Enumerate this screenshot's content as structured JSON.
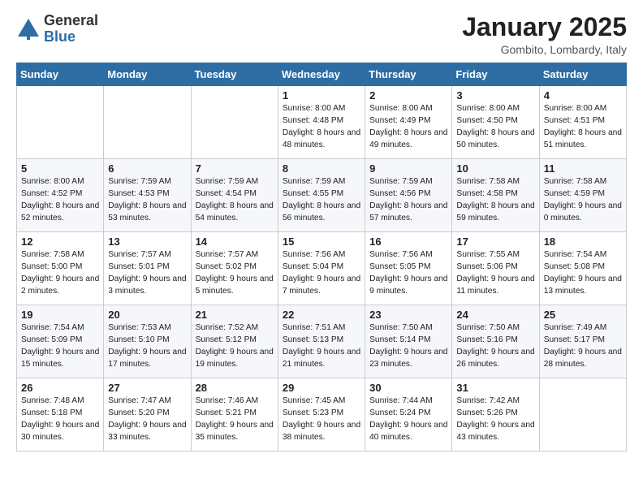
{
  "logo": {
    "general": "General",
    "blue": "Blue"
  },
  "title": "January 2025",
  "location": "Gombito, Lombardy, Italy",
  "weekdays": [
    "Sunday",
    "Monday",
    "Tuesday",
    "Wednesday",
    "Thursday",
    "Friday",
    "Saturday"
  ],
  "weeks": [
    [
      {
        "day": "",
        "sunrise": "",
        "sunset": "",
        "daylight": "",
        "empty": true
      },
      {
        "day": "",
        "sunrise": "",
        "sunset": "",
        "daylight": "",
        "empty": true
      },
      {
        "day": "",
        "sunrise": "",
        "sunset": "",
        "daylight": "",
        "empty": true
      },
      {
        "day": "1",
        "sunrise": "Sunrise: 8:00 AM",
        "sunset": "Sunset: 4:48 PM",
        "daylight": "Daylight: 8 hours and 48 minutes."
      },
      {
        "day": "2",
        "sunrise": "Sunrise: 8:00 AM",
        "sunset": "Sunset: 4:49 PM",
        "daylight": "Daylight: 8 hours and 49 minutes."
      },
      {
        "day": "3",
        "sunrise": "Sunrise: 8:00 AM",
        "sunset": "Sunset: 4:50 PM",
        "daylight": "Daylight: 8 hours and 50 minutes."
      },
      {
        "day": "4",
        "sunrise": "Sunrise: 8:00 AM",
        "sunset": "Sunset: 4:51 PM",
        "daylight": "Daylight: 8 hours and 51 minutes."
      }
    ],
    [
      {
        "day": "5",
        "sunrise": "Sunrise: 8:00 AM",
        "sunset": "Sunset: 4:52 PM",
        "daylight": "Daylight: 8 hours and 52 minutes."
      },
      {
        "day": "6",
        "sunrise": "Sunrise: 7:59 AM",
        "sunset": "Sunset: 4:53 PM",
        "daylight": "Daylight: 8 hours and 53 minutes."
      },
      {
        "day": "7",
        "sunrise": "Sunrise: 7:59 AM",
        "sunset": "Sunset: 4:54 PM",
        "daylight": "Daylight: 8 hours and 54 minutes."
      },
      {
        "day": "8",
        "sunrise": "Sunrise: 7:59 AM",
        "sunset": "Sunset: 4:55 PM",
        "daylight": "Daylight: 8 hours and 56 minutes."
      },
      {
        "day": "9",
        "sunrise": "Sunrise: 7:59 AM",
        "sunset": "Sunset: 4:56 PM",
        "daylight": "Daylight: 8 hours and 57 minutes."
      },
      {
        "day": "10",
        "sunrise": "Sunrise: 7:58 AM",
        "sunset": "Sunset: 4:58 PM",
        "daylight": "Daylight: 8 hours and 59 minutes."
      },
      {
        "day": "11",
        "sunrise": "Sunrise: 7:58 AM",
        "sunset": "Sunset: 4:59 PM",
        "daylight": "Daylight: 9 hours and 0 minutes."
      }
    ],
    [
      {
        "day": "12",
        "sunrise": "Sunrise: 7:58 AM",
        "sunset": "Sunset: 5:00 PM",
        "daylight": "Daylight: 9 hours and 2 minutes."
      },
      {
        "day": "13",
        "sunrise": "Sunrise: 7:57 AM",
        "sunset": "Sunset: 5:01 PM",
        "daylight": "Daylight: 9 hours and 3 minutes."
      },
      {
        "day": "14",
        "sunrise": "Sunrise: 7:57 AM",
        "sunset": "Sunset: 5:02 PM",
        "daylight": "Daylight: 9 hours and 5 minutes."
      },
      {
        "day": "15",
        "sunrise": "Sunrise: 7:56 AM",
        "sunset": "Sunset: 5:04 PM",
        "daylight": "Daylight: 9 hours and 7 minutes."
      },
      {
        "day": "16",
        "sunrise": "Sunrise: 7:56 AM",
        "sunset": "Sunset: 5:05 PM",
        "daylight": "Daylight: 9 hours and 9 minutes."
      },
      {
        "day": "17",
        "sunrise": "Sunrise: 7:55 AM",
        "sunset": "Sunset: 5:06 PM",
        "daylight": "Daylight: 9 hours and 11 minutes."
      },
      {
        "day": "18",
        "sunrise": "Sunrise: 7:54 AM",
        "sunset": "Sunset: 5:08 PM",
        "daylight": "Daylight: 9 hours and 13 minutes."
      }
    ],
    [
      {
        "day": "19",
        "sunrise": "Sunrise: 7:54 AM",
        "sunset": "Sunset: 5:09 PM",
        "daylight": "Daylight: 9 hours and 15 minutes."
      },
      {
        "day": "20",
        "sunrise": "Sunrise: 7:53 AM",
        "sunset": "Sunset: 5:10 PM",
        "daylight": "Daylight: 9 hours and 17 minutes."
      },
      {
        "day": "21",
        "sunrise": "Sunrise: 7:52 AM",
        "sunset": "Sunset: 5:12 PM",
        "daylight": "Daylight: 9 hours and 19 minutes."
      },
      {
        "day": "22",
        "sunrise": "Sunrise: 7:51 AM",
        "sunset": "Sunset: 5:13 PM",
        "daylight": "Daylight: 9 hours and 21 minutes."
      },
      {
        "day": "23",
        "sunrise": "Sunrise: 7:50 AM",
        "sunset": "Sunset: 5:14 PM",
        "daylight": "Daylight: 9 hours and 23 minutes."
      },
      {
        "day": "24",
        "sunrise": "Sunrise: 7:50 AM",
        "sunset": "Sunset: 5:16 PM",
        "daylight": "Daylight: 9 hours and 26 minutes."
      },
      {
        "day": "25",
        "sunrise": "Sunrise: 7:49 AM",
        "sunset": "Sunset: 5:17 PM",
        "daylight": "Daylight: 9 hours and 28 minutes."
      }
    ],
    [
      {
        "day": "26",
        "sunrise": "Sunrise: 7:48 AM",
        "sunset": "Sunset: 5:18 PM",
        "daylight": "Daylight: 9 hours and 30 minutes."
      },
      {
        "day": "27",
        "sunrise": "Sunrise: 7:47 AM",
        "sunset": "Sunset: 5:20 PM",
        "daylight": "Daylight: 9 hours and 33 minutes."
      },
      {
        "day": "28",
        "sunrise": "Sunrise: 7:46 AM",
        "sunset": "Sunset: 5:21 PM",
        "daylight": "Daylight: 9 hours and 35 minutes."
      },
      {
        "day": "29",
        "sunrise": "Sunrise: 7:45 AM",
        "sunset": "Sunset: 5:23 PM",
        "daylight": "Daylight: 9 hours and 38 minutes."
      },
      {
        "day": "30",
        "sunrise": "Sunrise: 7:44 AM",
        "sunset": "Sunset: 5:24 PM",
        "daylight": "Daylight: 9 hours and 40 minutes."
      },
      {
        "day": "31",
        "sunrise": "Sunrise: 7:42 AM",
        "sunset": "Sunset: 5:26 PM",
        "daylight": "Daylight: 9 hours and 43 minutes."
      },
      {
        "day": "",
        "sunrise": "",
        "sunset": "",
        "daylight": "",
        "empty": true
      }
    ]
  ]
}
